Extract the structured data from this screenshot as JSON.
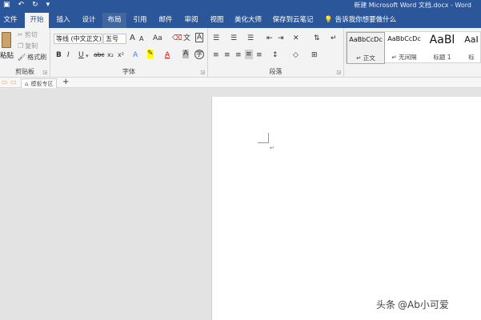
{
  "titlebar": {
    "qa_icons": [
      "save-icon",
      "undo-icon",
      "redo-icon",
      "customize-icon"
    ],
    "title": "新建 Microsoft Word 文档.docx - Word"
  },
  "tabs": [
    {
      "label": "文件"
    },
    {
      "label": "开始"
    },
    {
      "label": "插入"
    },
    {
      "label": "设计"
    },
    {
      "label": "布局"
    },
    {
      "label": "引用"
    },
    {
      "label": "邮件"
    },
    {
      "label": "审阅"
    },
    {
      "label": "视图"
    },
    {
      "label": "美化大师"
    },
    {
      "label": "保存到云笔记"
    }
  ],
  "tellme": {
    "icon": "lightbulb-icon",
    "text": "告诉我你想要做什么"
  },
  "clipboard": {
    "paste": "粘贴",
    "cut": "剪切",
    "copy": "复制",
    "format_painter": "格式刷",
    "label": "剪贴板"
  },
  "font": {
    "name": "等线 (中文正文)",
    "size": "五号",
    "label": "字体",
    "grow_icon": "A",
    "shrink_icon": "A",
    "case_icon": "Aa",
    "bold": "B",
    "italic": "I",
    "underline": "U",
    "strike": "abc",
    "subscript": "x₂",
    "superscript": "x²",
    "font_color_letter": "A"
  },
  "paragraph": {
    "label": "段落"
  },
  "styles": [
    {
      "preview": "AaBbCcDc",
      "name": "↵ 正文"
    },
    {
      "preview": "AaBbCcDc",
      "name": "↵ 无间隔"
    },
    {
      "preview": "AaBl",
      "name": "标题 1"
    },
    {
      "preview": "AaI",
      "name": "标"
    }
  ],
  "doc_tabs": {
    "template_area": "模板专区",
    "add": "+"
  },
  "document": {
    "paragraph_mark": "↵"
  },
  "watermark": {
    "prefix": "头条",
    "handle": "@Ab小可爱"
  },
  "colors": {
    "brand": "#2b579a",
    "ribbon": "#f3f3f3",
    "highlight": "#ffff00",
    "font_red": "#e00000"
  }
}
